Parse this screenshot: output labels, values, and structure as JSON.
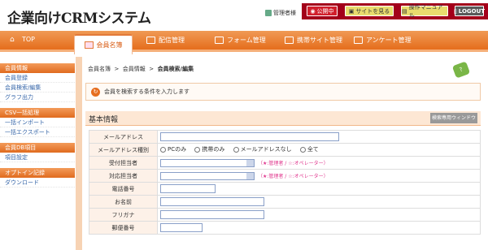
{
  "header": {
    "logo": "企業向けCRMシステム",
    "admin": "管理者様",
    "buttons": {
      "public": "公開中",
      "view_site": "サイトを見る",
      "manual": "操作マニュアル",
      "logout": "LOGOUT"
    }
  },
  "nav": {
    "items": [
      "TOP",
      "会員名簿",
      "配信管理",
      "フォーム管理",
      "携帯サイト管理",
      "アンケート管理"
    ]
  },
  "sidebar": {
    "sections": [
      {
        "title": "会員情報",
        "items": [
          "会員登録",
          "会員検索/編集",
          "グラフ出力"
        ]
      },
      {
        "title": "CSV一括処理",
        "items": [
          "一括インポート",
          "一括エクスポート"
        ]
      },
      {
        "title": "会員DB項目",
        "items": [
          "項目設定"
        ]
      },
      {
        "title": "オプトイン記録",
        "items": [
          "ダウンロード"
        ]
      }
    ]
  },
  "breadcrumb": {
    "a": "会員名簿",
    "b": "会員情報",
    "c": "会員検索/編集",
    "sep": ">"
  },
  "hint": "会員を検索する条件を入力します",
  "section": {
    "title": "基本情報",
    "button": "検索専用ウィンドウ"
  },
  "form": {
    "email": "メールアドレス",
    "email_type": "メールアドレス種別",
    "radios": [
      "PCのみ",
      "携帯のみ",
      "メールアドレスなし",
      "全て"
    ],
    "reception": "受付担当者",
    "handler": "対応担当者",
    "legend": "（★:管理者 / ☆:オペレーター）",
    "phone": "電話番号",
    "name": "お名前",
    "furigana": "フリガナ",
    "postal": "郵便番号"
  }
}
